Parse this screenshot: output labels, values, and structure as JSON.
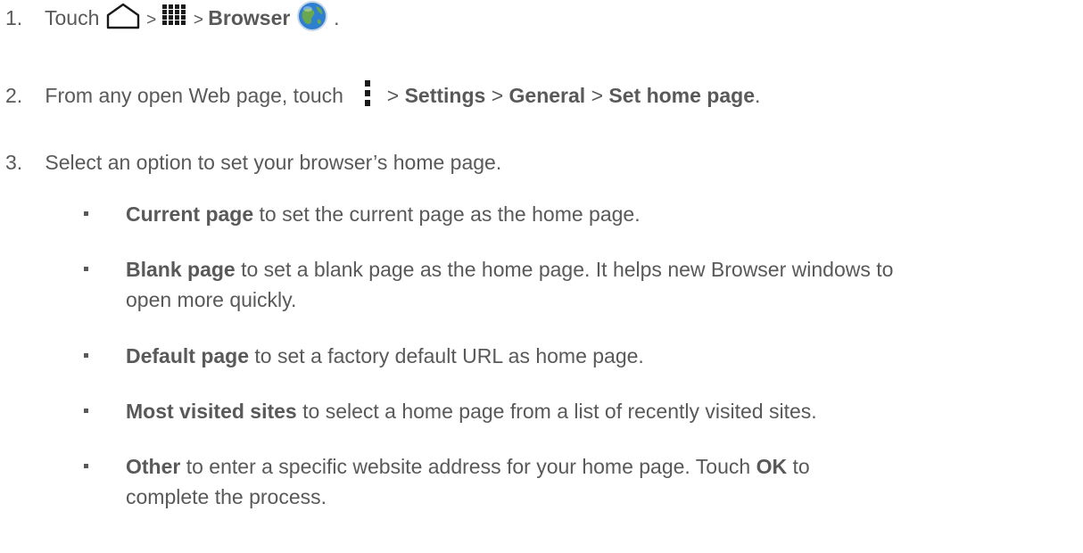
{
  "steps": [
    {
      "number": "1.",
      "pre": "Touch",
      "sep1": ">",
      "sep2": ">",
      "bold1": "Browser",
      "post": ".",
      "icons": [
        "home-icon",
        "apps-grid-icon",
        "browser-globe-icon"
      ]
    },
    {
      "number": "2.",
      "pre": "From any open Web page, touch",
      "sep1": ">",
      "bold1": "Settings",
      "sep2": ">",
      "bold2": "General",
      "sep3": ">",
      "bold3": "Set home page",
      "post": ".",
      "icons": [
        "menu-vertical-icon"
      ]
    },
    {
      "number": "3.",
      "text": "Select an option to set your browser’s home page."
    }
  ],
  "options": [
    {
      "bold": "Current page",
      "text": " to set the current page as the home page."
    },
    {
      "bold": "Blank page",
      "text": " to set a blank page as the home page. It helps new Browser windows to",
      "text2": "open more quickly."
    },
    {
      "bold": "Default page",
      "text": " to set a factory default URL as home page."
    },
    {
      "bold": "Most visited sites",
      "text": " to select a home page from a list of recently visited sites."
    },
    {
      "bold": "Other",
      "text": " to enter a specific website address for your home page. Touch ",
      "bold2": "OK",
      "text_after": " to",
      "text2": "complete the process."
    }
  ],
  "colors": {
    "text": "#595959",
    "globe_blue": "#2f7fd0",
    "globe_green": "#6aa84f"
  }
}
